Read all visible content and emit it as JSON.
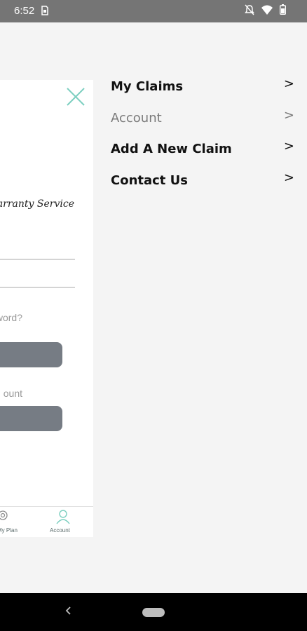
{
  "status_bar": {
    "time": "6:52",
    "icons": [
      "sim-icon",
      "notifications-off-icon",
      "wifi-icon",
      "battery-icon"
    ]
  },
  "panel": {
    "close_icon": "close-icon",
    "service_text": "Warranty Service",
    "forgot_hint": "word?",
    "account_hint": "ount",
    "tabs": [
      {
        "label": "My Plan",
        "icon": "plan-icon"
      },
      {
        "label": "Account",
        "icon": "account-icon"
      }
    ]
  },
  "menu": {
    "items": [
      {
        "label": "My Claims",
        "chevron": ">",
        "muted": false
      },
      {
        "label": "Account",
        "chevron": ">",
        "muted": true
      },
      {
        "label": "Add A New Claim",
        "chevron": ">",
        "muted": false
      },
      {
        "label": "Contact Us",
        "chevron": ">",
        "muted": false
      }
    ]
  },
  "colors": {
    "status_bar": "#757575",
    "panel_bg": "#ffffff",
    "accent_teal": "#7ccfc0",
    "button_gray": "#767c84",
    "drawer_bg": "#f4f4f4"
  }
}
